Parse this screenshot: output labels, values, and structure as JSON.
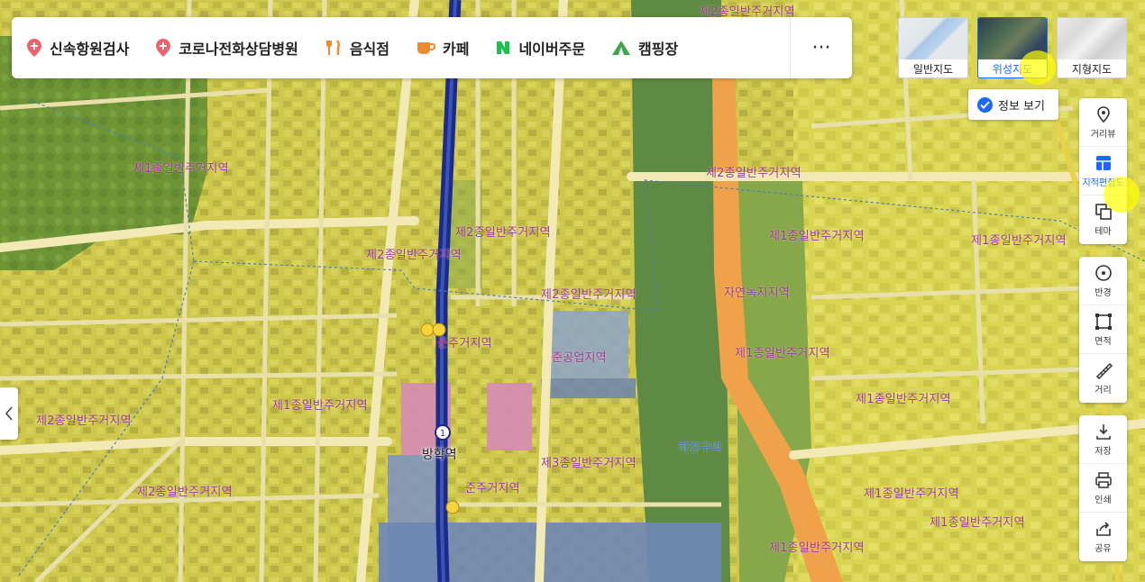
{
  "categories": [
    {
      "label": "신속항원검사",
      "icon": "pin-icon"
    },
    {
      "label": "코로나전화상담병원",
      "icon": "pin-icon"
    },
    {
      "label": "음식점",
      "icon": "fork-knife-icon"
    },
    {
      "label": "카페",
      "icon": "cup-icon"
    },
    {
      "label": "네이버주문",
      "icon": "naver-n-icon"
    },
    {
      "label": "캠핑장",
      "icon": "tent-icon"
    }
  ],
  "more_label": "···",
  "map_types": [
    {
      "label": "일반지도",
      "active": false
    },
    {
      "label": "위성지도",
      "active": true
    },
    {
      "label": "지형지도",
      "active": false
    }
  ],
  "info_toggle": {
    "label": "정보 보기",
    "checked": true
  },
  "tools": {
    "group1": [
      {
        "label": "거리뷰",
        "icon": "streetview-pin-icon"
      },
      {
        "label": "지적편집도",
        "icon": "cadastral-grid-icon",
        "active": true
      },
      {
        "label": "테마",
        "icon": "theme-layers-icon"
      }
    ],
    "group2": [
      {
        "label": "반경",
        "icon": "radius-icon"
      },
      {
        "label": "면적",
        "icon": "area-icon"
      },
      {
        "label": "거리",
        "icon": "ruler-icon"
      }
    ],
    "group3": [
      {
        "label": "저장",
        "icon": "download-icon"
      },
      {
        "label": "인쇄",
        "icon": "print-icon"
      },
      {
        "label": "공유",
        "icon": "share-icon"
      }
    ]
  },
  "zone_labels": [
    "제2종일반주거지역",
    "제1종일반주거지역",
    "제2종일반주거지역",
    "제2종일반주거지역",
    "제2종일반주거지역",
    "제2종일반주거지역",
    "제1종일반주거지역",
    "제1종일반주거지역",
    "자연녹지지역",
    "준주거지역",
    "준공업지역",
    "제1종일반주거지역",
    "제1종일반주거지역",
    "제2종일반주거지역",
    "하천구역",
    "제3종일반주거지역",
    "준주거지역",
    "제2종일반주거지역",
    "제1종일반주거지역",
    "제1종일반주거지역",
    "제1종일반주거지역",
    "제1종일반주거지역"
  ],
  "station": {
    "name": "방학역",
    "line": "1"
  },
  "colors": {
    "residential1": "#d4d045",
    "residential2": "#c7c24e",
    "green": "#6f9a3a",
    "river": "#5f8a43",
    "road": "#f3e9b5",
    "expressway": "#f0a24a",
    "industrial": "#8fa5c2",
    "commercial": "#d68bb4",
    "subway": "#1c2a8a",
    "accent": "#1b69ff"
  }
}
